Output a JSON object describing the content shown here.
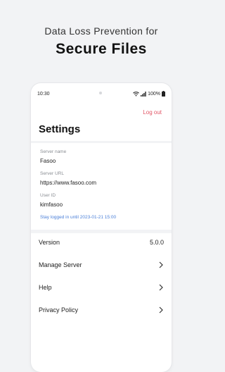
{
  "promo": {
    "subtitle": "Data Loss Prevention for",
    "title": "Secure Files"
  },
  "status_bar": {
    "time": "10:30",
    "battery": "100%"
  },
  "header": {
    "logout_label": "Log out",
    "title": "Settings"
  },
  "account": {
    "server_name_label": "Server name",
    "server_name_value": "Fasoo",
    "server_url_label": "Server URL",
    "server_url_value": "https://www.fasoo.com",
    "user_id_label": "User ID",
    "user_id_value": "kimfasoo",
    "stay_logged_in": "Stay logged in until 2023-01-21 15:00"
  },
  "menu": {
    "version_label": "Version",
    "version_value": "5.0.0",
    "manage_server_label": "Manage Server",
    "help_label": "Help",
    "privacy_policy_label": "Privacy Policy"
  },
  "colors": {
    "accent_logout": "#e25565",
    "accent_link": "#4a7fd8",
    "background": "#f2f3f5"
  }
}
